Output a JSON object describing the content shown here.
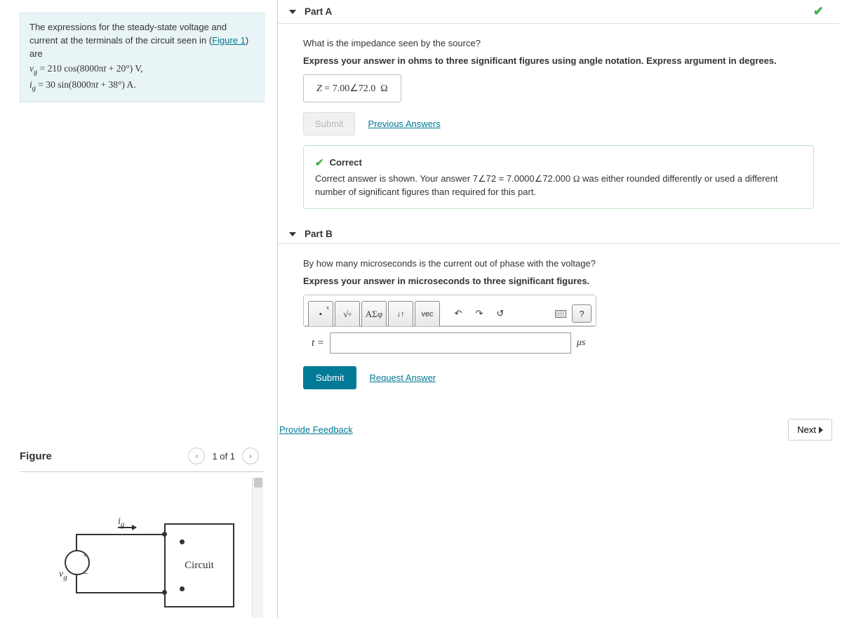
{
  "problem": {
    "intro_pre": "The expressions for the steady-state voltage and current at the terminals of the circuit seen in (",
    "figure_link": "Figure 1",
    "intro_post": ") are",
    "line_v": "v_g = 210 cos(8000πt + 20°) V,",
    "line_i": "i_g = 30 sin(8000πt + 38°) A."
  },
  "figure": {
    "heading": "Figure",
    "pager": "1 of 1",
    "box_label": "Circuit",
    "vg_label": "v_g",
    "ig_label": "i_g"
  },
  "partA": {
    "heading": "Part A",
    "question": "What is the impedance seen by the source?",
    "instruction": "Express your answer in ohms to three significant figures using angle notation. Express argument in degrees.",
    "answer_display": "Z = 7.00∠72.0 Ω",
    "submit_label": "Submit",
    "previous_answers": "Previous Answers",
    "feedback_title": "Correct",
    "feedback_body": "Correct answer is shown. Your answer 7∠72 = 7.0000∠72.000 Ω was either rounded differently or used a different number of significant figures than required for this part."
  },
  "partB": {
    "heading": "Part B",
    "question": "By how many microseconds is the current out of phase with the voltage?",
    "instruction": "Express your answer in microseconds to three significant figures.",
    "answer_var": "t =",
    "answer_value": "",
    "unit": "μs",
    "submit_label": "Submit",
    "request_answer": "Request Answer",
    "toolbar_greek": "ΑΣφ",
    "toolbar_vec": "vec",
    "toolbar_help": "?"
  },
  "footer": {
    "provide_feedback": "Provide Feedback",
    "next": "Next"
  }
}
